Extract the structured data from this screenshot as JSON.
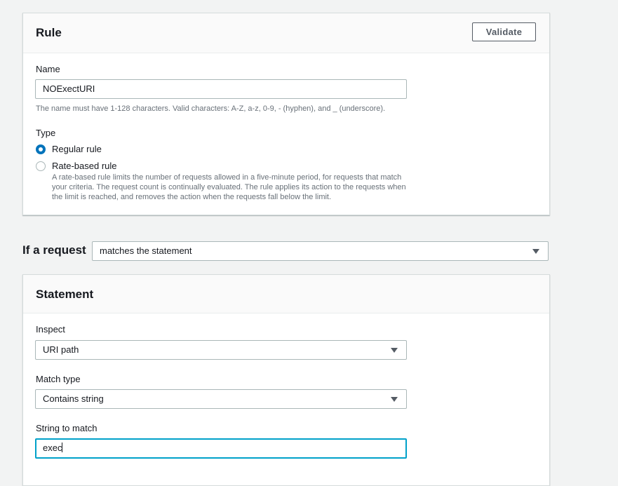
{
  "rule": {
    "title": "Rule",
    "validate_label": "Validate",
    "name_label": "Name",
    "name_value": "NOExectURI",
    "name_hint": "The name must have 1-128 characters. Valid characters: A-Z, a-z, 0-9, - (hyphen), and _ (underscore).",
    "type_label": "Type",
    "type_options": [
      {
        "label": "Regular rule",
        "checked": true,
        "description": ""
      },
      {
        "label": "Rate-based rule",
        "checked": false,
        "description": "A rate-based rule limits the number of requests allowed in a five-minute period, for requests that match your criteria. The request count is continually evaluated. The rule applies its action to the requests when the limit is reached, and removes the action when the requests fall below the limit."
      }
    ]
  },
  "condition": {
    "label": "If a request",
    "selected": "matches the statement"
  },
  "statement": {
    "title": "Statement",
    "inspect_label": "Inspect",
    "inspect_value": "URI path",
    "match_type_label": "Match type",
    "match_type_value": "Contains string",
    "string_label": "String to match",
    "string_value": "exec"
  },
  "colors": {
    "accent": "#0073bb",
    "focus": "#00a1c9",
    "background": "#f2f3f3"
  }
}
